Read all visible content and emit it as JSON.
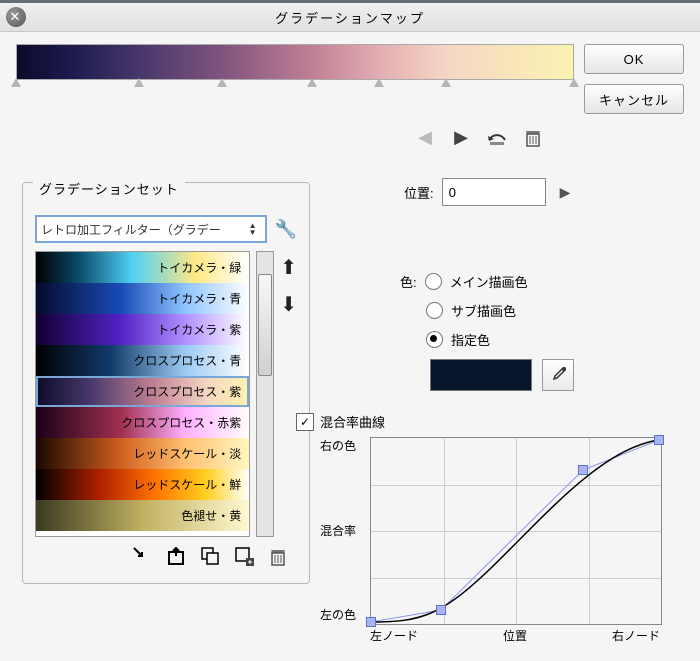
{
  "title": "グラデーションマップ",
  "buttons": {
    "ok": "OK",
    "cancel": "キャンセル"
  },
  "markers": [
    0,
    22,
    37,
    53,
    65,
    77,
    100
  ],
  "position": {
    "label": "位置:",
    "value": "0"
  },
  "gset": {
    "title": "グラデーションセット",
    "combo": "レトロ加工フィルター（グラデー",
    "items": [
      {
        "label": "トイカメラ・緑",
        "bg": "linear-gradient(to right,#000,#0a4a6a 20%,#4fd0f5 45%,#ffe884 75%,#fff)"
      },
      {
        "label": "トイカメラ・青",
        "bg": "linear-gradient(to right,#050b2c,#1a4bb8 40%,#8fc4ff 70%,#fff)"
      },
      {
        "label": "トイカメラ・紫",
        "bg": "linear-gradient(to right,#100032,#5322c6 40%,#b090ff 70%,#fff)"
      },
      {
        "label": "クロスプロセス・青",
        "bg": "linear-gradient(to right,#000,#123a6a 35%,#9ccaf3 70%,#fff)"
      },
      {
        "label": "クロスプロセス・紫",
        "bg": "linear-gradient(to right,#0a0a29,#47376b 25%,#c07f93 55%,#f4d6c3 80%,#fcf3b0)",
        "sel": true
      },
      {
        "label": "クロスプロセス・赤紫",
        "bg": "linear-gradient(to right,#1a0018,#a03050 40%,#ffb0ff 70%,#fff)"
      },
      {
        "label": "レッドスケール・淡",
        "bg": "linear-gradient(to right,#1a0800,#d06020 40%,#ffc070 70%,#fff7c0)"
      },
      {
        "label": "レッドスケール・鮮",
        "bg": "linear-gradient(to right,#000,#b02000 30%,#ff7000 55%,#ffd020 80%,#fff)"
      },
      {
        "label": "色褪せ・黄",
        "bg": "linear-gradient(to right,#3a3a20,#c0b060,#fff8d0)"
      }
    ]
  },
  "colorSec": {
    "label": "色:",
    "opts": {
      "main": "メイン描画色",
      "sub": "サブ描画色",
      "spec": "指定色"
    },
    "selected": "spec",
    "swatch": "#08142a"
  },
  "curve": {
    "check": "混合率曲線",
    "ylabels": [
      "右の色",
      "混合率",
      "左の色"
    ],
    "xlabels": [
      "左ノード",
      "位置",
      "右ノード"
    ]
  }
}
